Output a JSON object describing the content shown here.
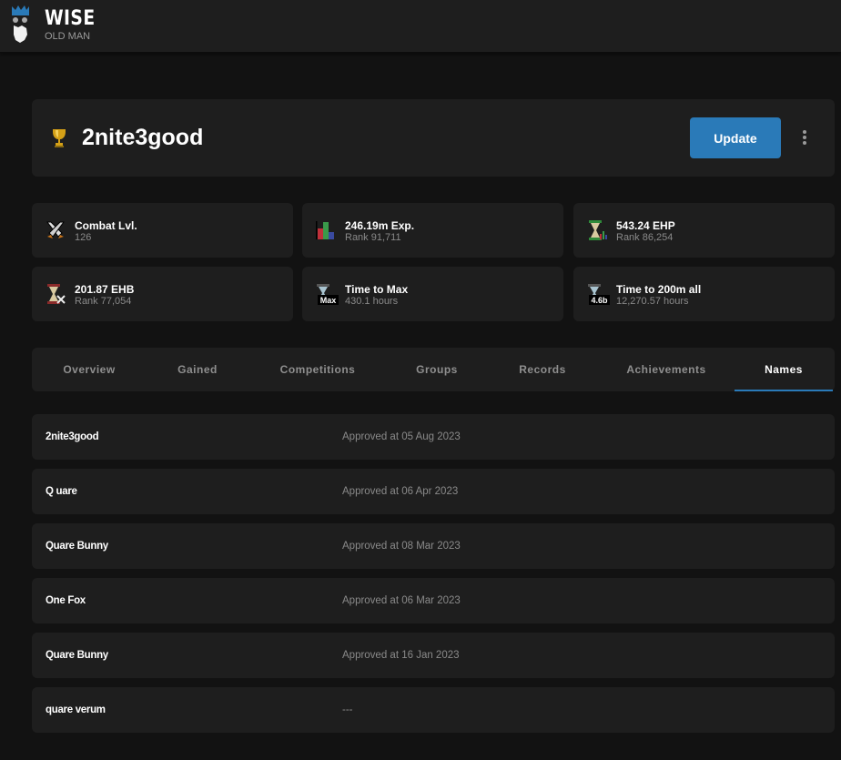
{
  "brand": {
    "title": "WISE",
    "subtitle": "OLD MAN"
  },
  "player": {
    "name": "2nite3good",
    "update_label": "Update"
  },
  "colors": {
    "accent": "#2a7ab8",
    "background": "#121212",
    "card": "#1e1e1e"
  },
  "stats": [
    {
      "icon": "crossed-swords-icon",
      "title": "Combat Lvl.",
      "value": "126"
    },
    {
      "icon": "bar-chart-icon",
      "title": "246.19m Exp.",
      "value": "Rank 91,711"
    },
    {
      "icon": "hourglass-ehp-icon",
      "title": "543.24 EHP",
      "value": "Rank 86,254"
    },
    {
      "icon": "hourglass-ehb-icon",
      "title": "201.87 EHB",
      "value": "Rank 77,054"
    },
    {
      "icon": "hourglass-max-icon",
      "title": "Time to Max",
      "value": "430.1 hours",
      "badge": "Max"
    },
    {
      "icon": "hourglass-200m-icon",
      "title": "Time to 200m all",
      "value": "12,270.57 hours",
      "badge": "4.6b"
    }
  ],
  "tabs": [
    {
      "label": "Overview"
    },
    {
      "label": "Gained"
    },
    {
      "label": "Competitions"
    },
    {
      "label": "Groups"
    },
    {
      "label": "Records"
    },
    {
      "label": "Achievements"
    },
    {
      "label": "Names",
      "active": true
    }
  ],
  "names": [
    {
      "name": "2nite3good",
      "date": "Approved at 05 Aug 2023"
    },
    {
      "name": "Q uare",
      "date": "Approved at 06 Apr 2023"
    },
    {
      "name": "Quare Bunny",
      "date": "Approved at 08 Mar 2023"
    },
    {
      "name": "One Fox",
      "date": "Approved at 06 Mar 2023"
    },
    {
      "name": "Quare Bunny",
      "date": "Approved at 16 Jan 2023"
    },
    {
      "name": "quare verum",
      "date": "---"
    }
  ]
}
